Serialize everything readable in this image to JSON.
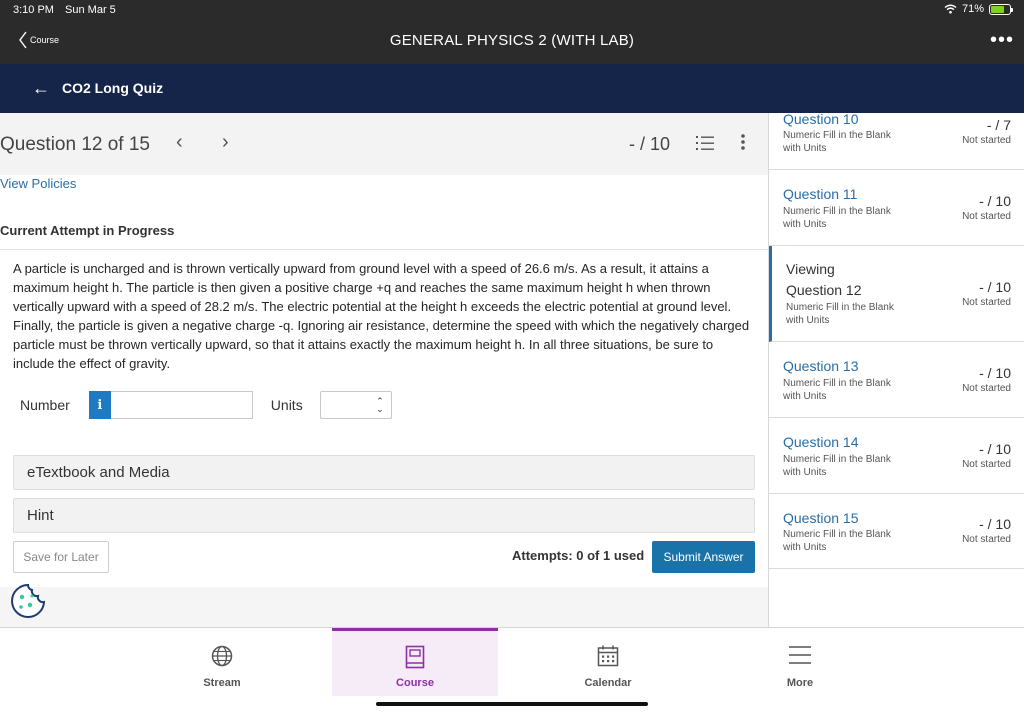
{
  "status_bar": {
    "time": "3:10 PM",
    "date": "Sun Mar 5",
    "battery": "71%"
  },
  "app_bar": {
    "back_label": "Course",
    "title": "GENERAL PHYSICS 2 (WITH LAB)",
    "more_glyph": "•••"
  },
  "assignment": {
    "title": "CO2 Long Quiz"
  },
  "question_bar": {
    "title": "Question 12 of 15",
    "prev_glyph": "‹",
    "next_glyph": "›",
    "score": "- / 10"
  },
  "main": {
    "view_policies": "View Policies",
    "attempt_heading": "Current Attempt in Progress",
    "question_text": "A particle is uncharged and is thrown vertically upward from ground level with a speed of 26.6 m/s. As a result, it attains a maximum height h. The particle is then given a positive charge +q and reaches the same maximum height h when thrown vertically upward with a speed of 28.2 m/s. The electric potential at the height h exceeds the electric potential at ground level. Finally, the particle is given a negative charge -q. Ignoring air resistance, determine the speed with which the negatively charged particle must be thrown vertically upward, so that it attains exactly the maximum height h. In all three situations, be sure to include the effect of gravity.",
    "number_label": "Number",
    "info_glyph": "i",
    "number_value": "",
    "units_label": "Units",
    "units_value": "",
    "etextbook_label": "eTextbook and Media",
    "hint_label": "Hint",
    "save_label": "Save for Later",
    "attempts_text": "Attempts: 0 of 1 used",
    "submit_label": "Submit Answer"
  },
  "sidebar": {
    "items": [
      {
        "name": "Question 10",
        "type": "Numeric Fill in the Blank with Units",
        "points": "- / 7",
        "status": "Not started"
      },
      {
        "name": "Question 11",
        "type": "Numeric Fill in the Blank with Units",
        "points": "- / 10",
        "status": "Not started"
      },
      {
        "viewing": "Viewing",
        "name": "Question 12",
        "type": "Numeric Fill in the Blank with Units",
        "points": "- / 10",
        "status": "Not started"
      },
      {
        "name": "Question 13",
        "type": "Numeric Fill in the Blank with Units",
        "points": "- / 10",
        "status": "Not started"
      },
      {
        "name": "Question 14",
        "type": "Numeric Fill in the Blank with Units",
        "points": "- / 10",
        "status": "Not started"
      },
      {
        "name": "Question 15",
        "type": "Numeric Fill in the Blank with Units",
        "points": "- / 10",
        "status": "Not started"
      }
    ]
  },
  "tabbar": {
    "tabs": [
      {
        "label": "Stream",
        "icon": "globe-icon"
      },
      {
        "label": "Course",
        "icon": "book-icon"
      },
      {
        "label": "Calendar",
        "icon": "calendar-icon"
      },
      {
        "label": "More",
        "icon": "menu-icon"
      }
    ]
  },
  "colors": {
    "nav_header": "#152449",
    "link": "#2a6ea6",
    "submit": "#1a73a8",
    "active_tab": "#8e2fa6",
    "battery": "#7ed321"
  }
}
